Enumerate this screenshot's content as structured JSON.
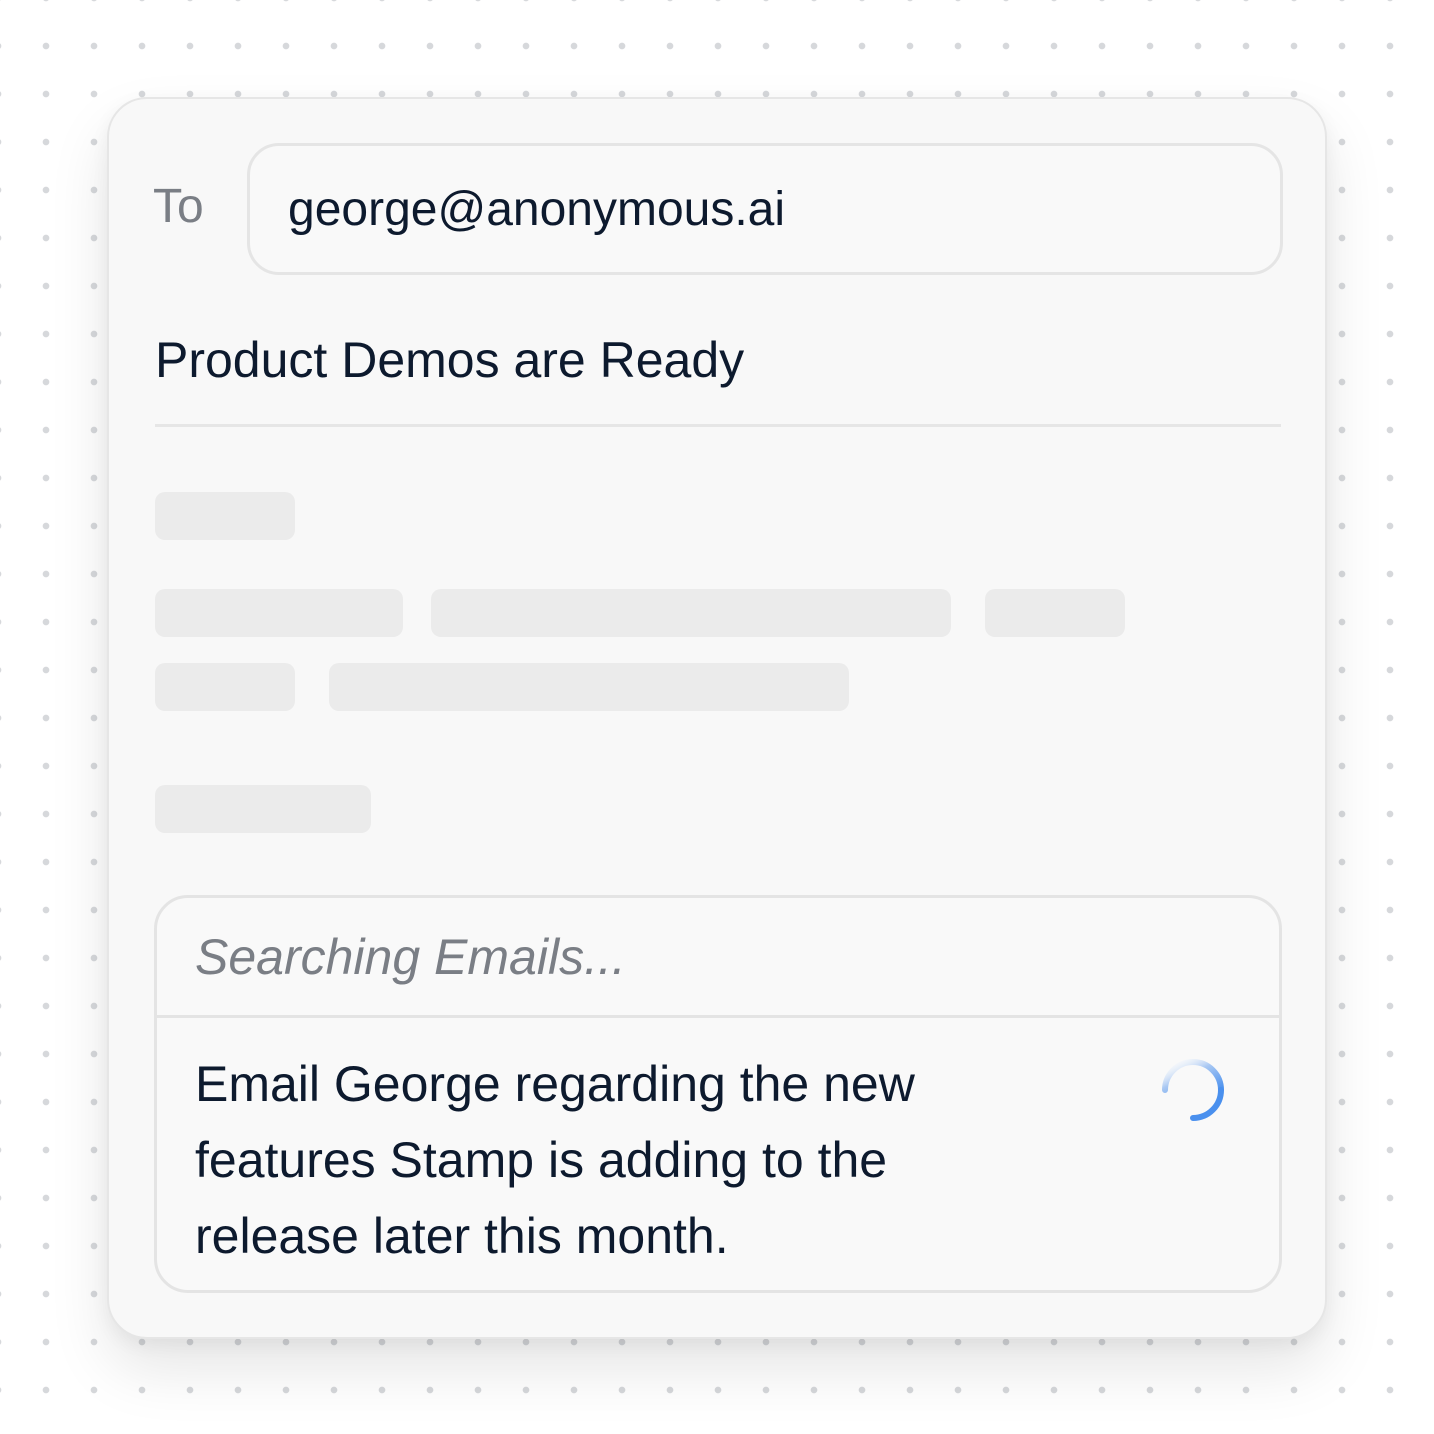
{
  "compose": {
    "to_label": "To",
    "to_value": "george@anonymous.ai",
    "subject": "Product Demos are Ready"
  },
  "assistant": {
    "status": "Searching Emails...",
    "prompt": "Email George regarding the new features Stamp is adding to the release later this month.",
    "spinner_icon": "loading-spinner-icon",
    "accent_color": "#5b9cf0"
  }
}
